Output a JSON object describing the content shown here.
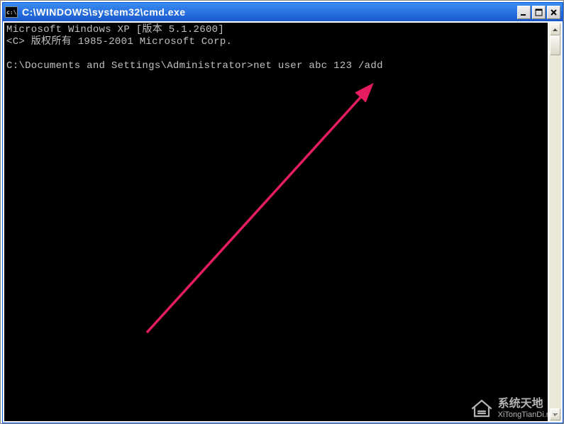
{
  "window": {
    "title": "C:\\WINDOWS\\system32\\cmd.exe",
    "icon_label": "c:\\"
  },
  "terminal": {
    "line1": "Microsoft Windows XP [版本 5.1.2600]",
    "line2": "<C> 版权所有 1985-2001 Microsoft Corp.",
    "line3": "",
    "prompt": "C:\\Documents and Settings\\Administrator>",
    "command": "net user abc 123 /add"
  },
  "watermark": {
    "name": "系统天地",
    "url": "XiTongTianDi.net"
  }
}
